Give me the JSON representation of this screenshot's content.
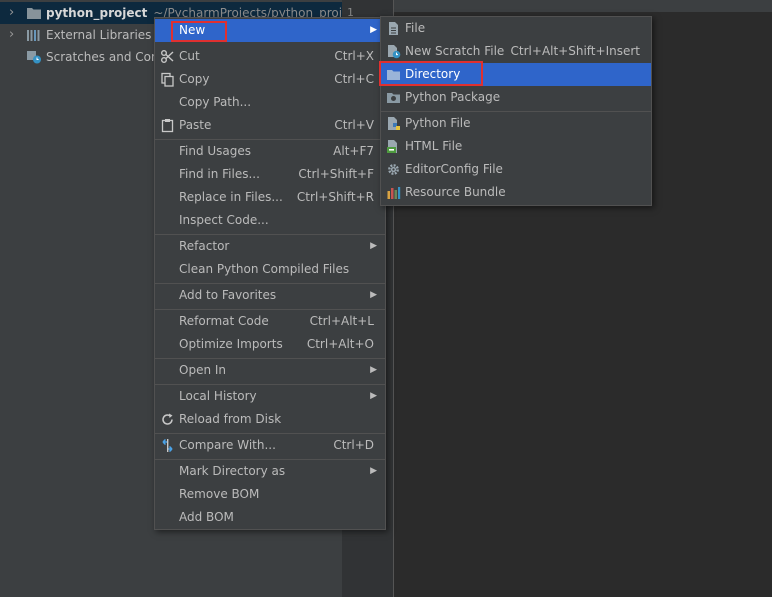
{
  "project_tree": {
    "project_name": "python_project",
    "project_path": "~/PycharmProjects/python_project",
    "external_libraries": "External Libraries",
    "scratches": "Scratches and Consoles"
  },
  "editor": {
    "line_number": "1"
  },
  "context_menu": {
    "items": [
      {
        "label": "New",
        "shortcut": "",
        "submenu": true
      },
      {
        "label": "Cut",
        "shortcut": "Ctrl+X"
      },
      {
        "label": "Copy",
        "shortcut": "Ctrl+C"
      },
      {
        "label": "Copy Path...",
        "shortcut": ""
      },
      {
        "label": "Paste",
        "shortcut": "Ctrl+V"
      },
      {
        "label": "Find Usages",
        "shortcut": "Alt+F7"
      },
      {
        "label": "Find in Files...",
        "shortcut": "Ctrl+Shift+F"
      },
      {
        "label": "Replace in Files...",
        "shortcut": "Ctrl+Shift+R"
      },
      {
        "label": "Inspect Code...",
        "shortcut": ""
      },
      {
        "label": "Refactor",
        "shortcut": "",
        "submenu": true
      },
      {
        "label": "Clean Python Compiled Files",
        "shortcut": ""
      },
      {
        "label": "Add to Favorites",
        "shortcut": "",
        "submenu": true
      },
      {
        "label": "Reformat Code",
        "shortcut": "Ctrl+Alt+L"
      },
      {
        "label": "Optimize Imports",
        "shortcut": "Ctrl+Alt+O"
      },
      {
        "label": "Open In",
        "shortcut": "",
        "submenu": true
      },
      {
        "label": "Local History",
        "shortcut": "",
        "submenu": true
      },
      {
        "label": "Reload from Disk",
        "shortcut": ""
      },
      {
        "label": "Compare With...",
        "shortcut": "Ctrl+D"
      },
      {
        "label": "Mark Directory as",
        "shortcut": "",
        "submenu": true
      },
      {
        "label": "Remove BOM",
        "shortcut": ""
      },
      {
        "label": "Add BOM",
        "shortcut": ""
      }
    ]
  },
  "new_submenu": {
    "items": [
      {
        "label": "File",
        "shortcut": "",
        "icon": "file-icon"
      },
      {
        "label": "New Scratch File",
        "shortcut": "Ctrl+Alt+Shift+Insert",
        "icon": "scratch-file-icon"
      },
      {
        "label": "Directory",
        "shortcut": "",
        "icon": "folder-icon"
      },
      {
        "label": "Python Package",
        "shortcut": "",
        "icon": "python-package-icon"
      },
      {
        "label": "Python File",
        "shortcut": "",
        "icon": "python-file-icon"
      },
      {
        "label": "HTML File",
        "shortcut": "",
        "icon": "html-file-icon"
      },
      {
        "label": "EditorConfig File",
        "shortcut": "",
        "icon": "editorconfig-gear-icon"
      },
      {
        "label": "Resource Bundle",
        "shortcut": "",
        "icon": "resource-bundle-icon"
      }
    ]
  },
  "colors": {
    "menu_bg": "#3c3f41",
    "selection": "#2f65ca",
    "highlight_box": "#e03030",
    "editor_bg": "#2b2b2b"
  }
}
